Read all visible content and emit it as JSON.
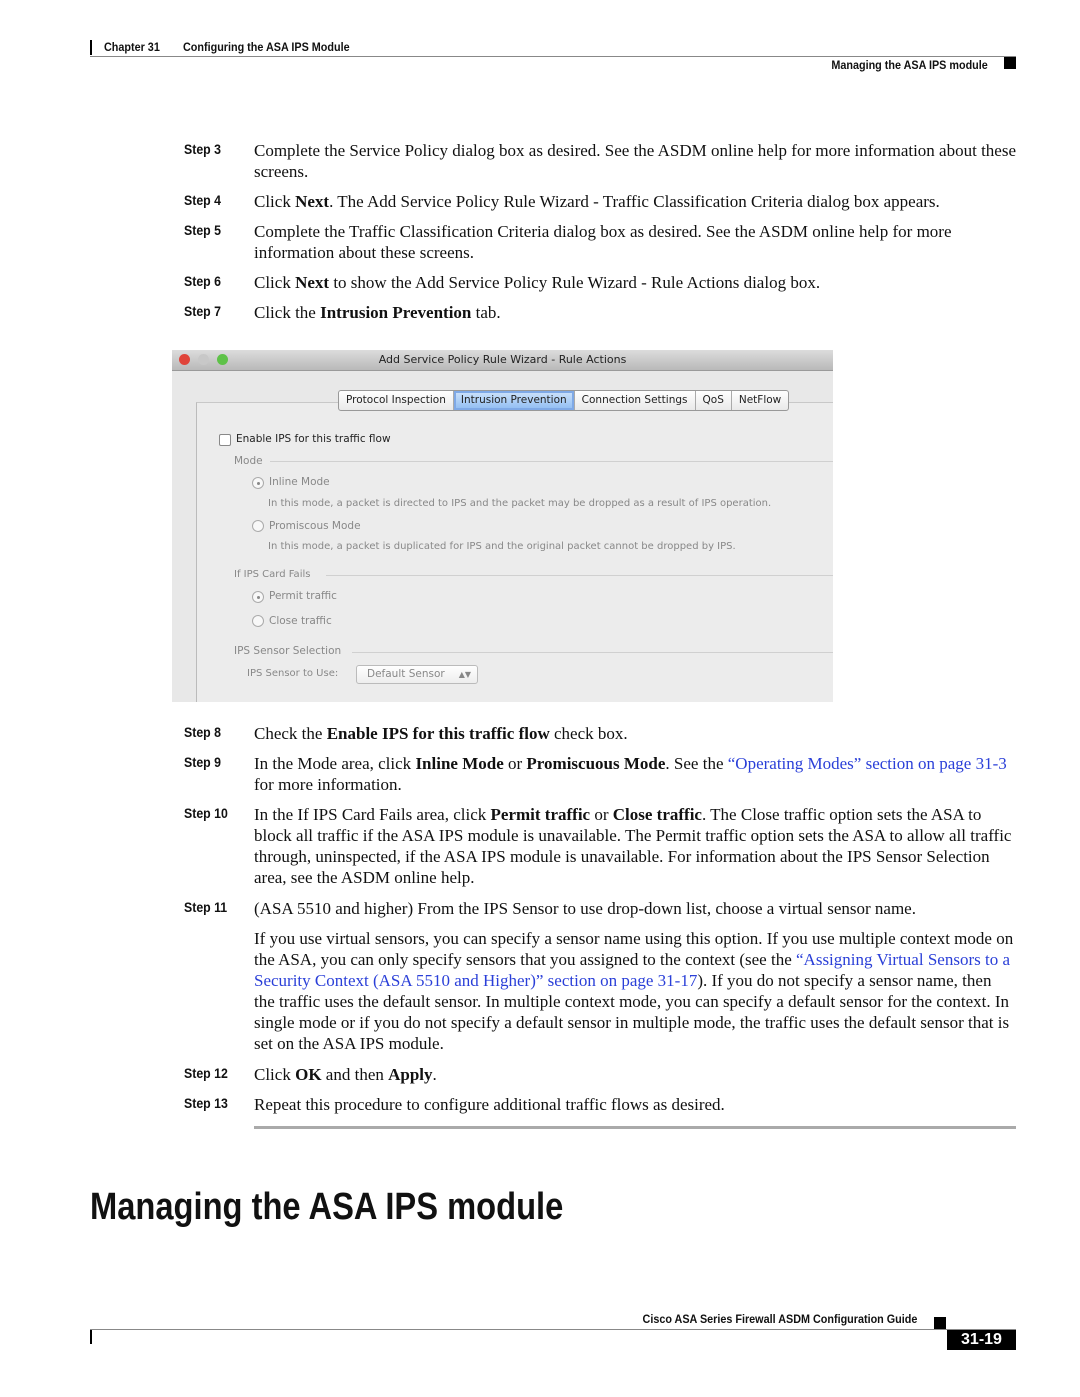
{
  "header": {
    "chapter": "Chapter 31",
    "chapter_title": "Configuring the ASA IPS Module",
    "section": "Managing the ASA IPS module"
  },
  "steps": [
    {
      "label": "Step 3",
      "segments": [
        {
          "t": "Complete the Service Policy dialog box as desired. See the ASDM online help for more information about these screens."
        }
      ]
    },
    {
      "label": "Step 4",
      "segments": [
        {
          "t": "Click "
        },
        {
          "t": "Next",
          "b": true
        },
        {
          "t": ". The Add Service Policy Rule Wizard - Traffic Classification Criteria dialog box appears."
        }
      ]
    },
    {
      "label": "Step 5",
      "segments": [
        {
          "t": "Complete the Traffic Classification Criteria dialog box as desired. See the ASDM online help for more information about these screens."
        }
      ]
    },
    {
      "label": "Step 6",
      "segments": [
        {
          "t": "Click "
        },
        {
          "t": "Next",
          "b": true
        },
        {
          "t": " to show the Add Service Policy Rule Wizard - Rule Actions dialog box."
        }
      ]
    },
    {
      "label": "Step 7",
      "segments": [
        {
          "t": "Click the "
        },
        {
          "t": "Intrusion Prevention",
          "b": true
        },
        {
          "t": " tab."
        }
      ]
    },
    {
      "label": "Step 8",
      "segments": [
        {
          "t": "Check the "
        },
        {
          "t": "Enable IPS for this traffic flow",
          "b": true
        },
        {
          "t": " check box."
        }
      ]
    },
    {
      "label": "Step 9",
      "segments": [
        {
          "t": "In the Mode area, click "
        },
        {
          "t": "Inline Mode",
          "b": true
        },
        {
          "t": " or "
        },
        {
          "t": "Promiscuous Mode",
          "b": true
        },
        {
          "t": ". See the "
        },
        {
          "t": "“Operating Modes” section on page 31-3",
          "link": true
        },
        {
          "t": " for more information."
        }
      ]
    },
    {
      "label": "Step 10",
      "segments": [
        {
          "t": "In the If IPS Card Fails area, click "
        },
        {
          "t": "Permit traffic",
          "b": true
        },
        {
          "t": " or "
        },
        {
          "t": "Close traffic",
          "b": true
        },
        {
          "t": ". The Close traffic option sets the ASA to block all traffic if the ASA IPS module is unavailable. The Permit traffic option sets the ASA to allow all traffic through, uninspected, if the ASA IPS module is unavailable. For information about the IPS Sensor Selection area, see the ASDM online help."
        }
      ]
    },
    {
      "label": "Step 11",
      "segments": [
        {
          "t": "(ASA 5510 and higher) From the IPS Sensor to use drop-down list, choose a virtual sensor name."
        }
      ]
    },
    {
      "label": "",
      "segments": [
        {
          "t": "If you use virtual sensors, you can specify a sensor name using this option. If you use multiple context mode on the ASA, you can only specify sensors that you assigned to the context (see the "
        },
        {
          "t": "“Assigning Virtual Sensors to a Security Context (ASA 5510 and Higher)” section on page 31-17",
          "link": true
        },
        {
          "t": "). If you do not specify a sensor name, then the traffic uses the default sensor. In multiple context mode, you can specify a default sensor for the context. In single mode or if you do not specify a default sensor in multiple mode, the traffic uses the default sensor that is set on the ASA IPS module."
        }
      ]
    },
    {
      "label": "Step 12",
      "segments": [
        {
          "t": "Click "
        },
        {
          "t": "OK",
          "b": true
        },
        {
          "t": " and then "
        },
        {
          "t": "Apply",
          "b": true
        },
        {
          "t": "."
        }
      ]
    },
    {
      "label": "Step 13",
      "segments": [
        {
          "t": "Repeat this procedure to configure additional traffic flows as desired."
        }
      ]
    }
  ],
  "dialog": {
    "title": "Add Service Policy Rule Wizard - Rule Actions",
    "tabs": [
      "Protocol Inspection",
      "Intrusion Prevention",
      "Connection Settings",
      "QoS",
      "NetFlow"
    ],
    "selected_tab": "Intrusion Prevention",
    "enable_checkbox": "Enable IPS for this traffic flow",
    "enable_checked": false,
    "mode_group": "Mode",
    "inline_mode": "Inline Mode",
    "inline_desc": "In this mode, a packet is directed to IPS and the packet may be dropped as a result of IPS operation.",
    "promiscuous_mode": "Promiscous Mode",
    "promiscuous_desc": "In this mode, a packet is duplicated for IPS and the original packet cannot be dropped by IPS.",
    "mode_selected": "Inline Mode",
    "fail_group": "If IPS Card Fails",
    "permit": "Permit traffic",
    "close": "Close traffic",
    "fail_selected": "Permit traffic",
    "sensor_group": "IPS Sensor Selection",
    "sensor_label": "IPS Sensor to Use:",
    "sensor_value": "Default Sensor",
    "traffic_light_colors": [
      "#e0443a",
      "#c8c8c8",
      "#5ec248"
    ]
  },
  "section_heading": "Managing the ASA IPS module",
  "footer": {
    "guide": "Cisco ASA Series Firewall ASDM Configuration Guide",
    "page": "31-19"
  }
}
